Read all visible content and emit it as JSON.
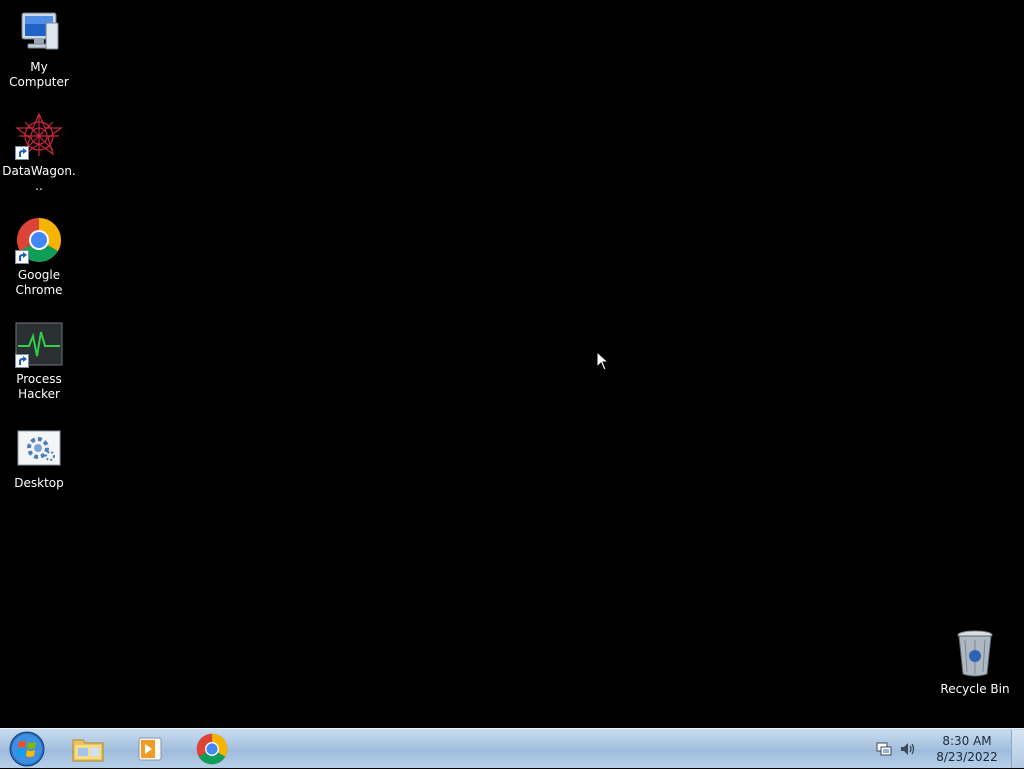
{
  "desktop": {
    "icons": [
      {
        "label": "My Computer",
        "icon": "computer-icon"
      },
      {
        "label": "DataWagon...",
        "icon": "datawagon-icon",
        "shortcut": true
      },
      {
        "label": "Google Chrome",
        "icon": "chrome-icon",
        "shortcut": true
      },
      {
        "label": "Process Hacker",
        "icon": "process-hacker-icon",
        "shortcut": true
      },
      {
        "label": "Desktop",
        "icon": "desktop-settings-icon"
      },
      {
        "label": "Recycle Bin",
        "icon": "recycle-bin-icon"
      }
    ]
  },
  "taskbar": {
    "start": {
      "icon": "windows-start-icon"
    },
    "pinned": [
      {
        "name": "Windows Explorer",
        "icon": "folder-icon"
      },
      {
        "name": "Windows Media Player",
        "icon": "media-player-icon"
      },
      {
        "name": "Google Chrome",
        "icon": "chrome-icon"
      }
    ],
    "tray": {
      "icons": [
        "network-icon",
        "volume-icon"
      ],
      "time": "8:30 AM",
      "date": "8/23/2022"
    }
  },
  "colors": {
    "desktop_background": "#000000",
    "taskbar": "#a9c4e0",
    "label_text": "#ffffff"
  }
}
